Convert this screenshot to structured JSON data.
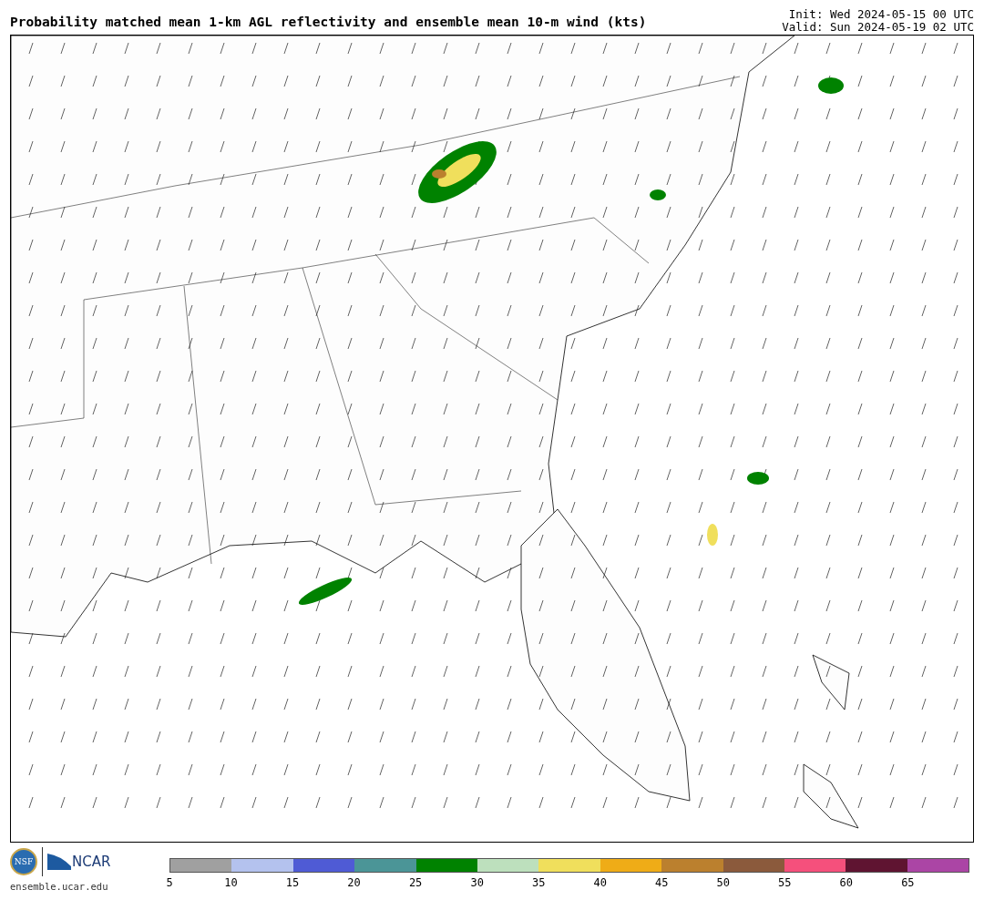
{
  "title": "Probability matched mean 1-km AGL reflectivity and ensemble mean 10-m wind (kts)",
  "init": "Init: Wed 2024-05-15 00 UTC",
  "valid": "Valid: Sun 2024-05-19 02 UTC",
  "logos": {
    "nsf": "NSF",
    "ncar": "NCAR",
    "url": "ensemble.ucar.edu"
  },
  "colorbar": {
    "bins": [
      {
        "color": "#a0a0a0"
      },
      {
        "color": "#b4c2ee"
      },
      {
        "color": "#4f5bd5"
      },
      {
        "color": "#4b9597"
      },
      {
        "color": "#008200"
      },
      {
        "color": "#bde0bd"
      },
      {
        "color": "#f0df5c"
      },
      {
        "color": "#efac17"
      },
      {
        "color": "#bb802e"
      },
      {
        "color": "#8b5a3c"
      },
      {
        "color": "#f5507c"
      },
      {
        "color": "#5f1431"
      },
      {
        "color": "#ab45a5"
      }
    ],
    "ticks": [
      "5",
      "10",
      "15",
      "20",
      "25",
      "30",
      "35",
      "40",
      "45",
      "50",
      "55",
      "60",
      "65"
    ]
  }
}
